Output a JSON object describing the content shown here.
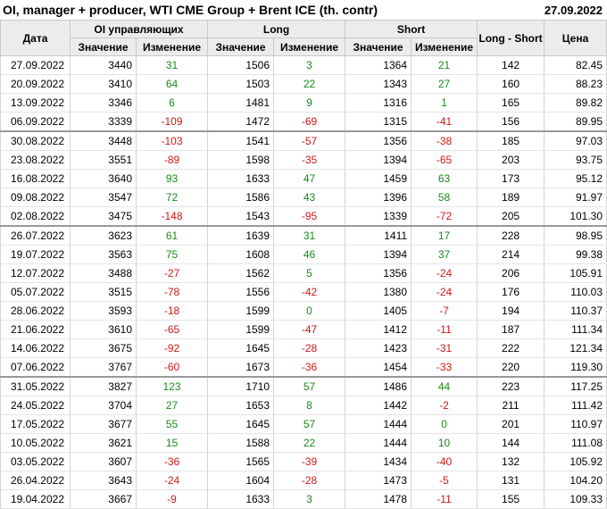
{
  "header": {
    "title": "OI, manager + producer, WTI CME Group + Brent ICE (th. contr)",
    "date": "27.09.2022"
  },
  "columns": {
    "date": "Дата",
    "oi_group": "OI управляющих",
    "long_group": "Long",
    "short_group": "Short",
    "long_short": "Long - Short",
    "price": "Цена",
    "value": "Значение",
    "change": "Изменение"
  },
  "rows": [
    {
      "date": "27.09.2022",
      "oi": "3440",
      "oi_chg": "31",
      "long": "1506",
      "long_chg": "3",
      "short": "1364",
      "short_chg": "21",
      "ls": "142",
      "price": "82.45"
    },
    {
      "date": "20.09.2022",
      "oi": "3410",
      "oi_chg": "64",
      "long": "1503",
      "long_chg": "22",
      "short": "1343",
      "short_chg": "27",
      "ls": "160",
      "price": "88.23"
    },
    {
      "date": "13.09.2022",
      "oi": "3346",
      "oi_chg": "6",
      "long": "1481",
      "long_chg": "9",
      "short": "1316",
      "short_chg": "1",
      "ls": "165",
      "price": "89.82"
    },
    {
      "date": "06.09.2022",
      "oi": "3339",
      "oi_chg": "-109",
      "long": "1472",
      "long_chg": "-69",
      "short": "1315",
      "short_chg": "-41",
      "ls": "156",
      "price": "89.95"
    },
    {
      "date": "30.08.2022",
      "oi": "3448",
      "oi_chg": "-103",
      "long": "1541",
      "long_chg": "-57",
      "short": "1356",
      "short_chg": "-38",
      "ls": "185",
      "price": "97.03",
      "sep": true
    },
    {
      "date": "23.08.2022",
      "oi": "3551",
      "oi_chg": "-89",
      "long": "1598",
      "long_chg": "-35",
      "short": "1394",
      "short_chg": "-65",
      "ls": "203",
      "price": "93.75"
    },
    {
      "date": "16.08.2022",
      "oi": "3640",
      "oi_chg": "93",
      "long": "1633",
      "long_chg": "47",
      "short": "1459",
      "short_chg": "63",
      "ls": "173",
      "price": "95.12"
    },
    {
      "date": "09.08.2022",
      "oi": "3547",
      "oi_chg": "72",
      "long": "1586",
      "long_chg": "43",
      "short": "1396",
      "short_chg": "58",
      "ls": "189",
      "price": "91.97"
    },
    {
      "date": "02.08.2022",
      "oi": "3475",
      "oi_chg": "-148",
      "long": "1543",
      "long_chg": "-95",
      "short": "1339",
      "short_chg": "-72",
      "ls": "205",
      "price": "101.30"
    },
    {
      "date": "26.07.2022",
      "oi": "3623",
      "oi_chg": "61",
      "long": "1639",
      "long_chg": "31",
      "short": "1411",
      "short_chg": "17",
      "ls": "228",
      "price": "98.95",
      "sep": true
    },
    {
      "date": "19.07.2022",
      "oi": "3563",
      "oi_chg": "75",
      "long": "1608",
      "long_chg": "46",
      "short": "1394",
      "short_chg": "37",
      "ls": "214",
      "price": "99.38"
    },
    {
      "date": "12.07.2022",
      "oi": "3488",
      "oi_chg": "-27",
      "long": "1562",
      "long_chg": "5",
      "short": "1356",
      "short_chg": "-24",
      "ls": "206",
      "price": "105.91"
    },
    {
      "date": "05.07.2022",
      "oi": "3515",
      "oi_chg": "-78",
      "long": "1556",
      "long_chg": "-42",
      "short": "1380",
      "short_chg": "-24",
      "ls": "176",
      "price": "110.03"
    },
    {
      "date": "28.06.2022",
      "oi": "3593",
      "oi_chg": "-18",
      "long": "1599",
      "long_chg": "0",
      "short": "1405",
      "short_chg": "-7",
      "ls": "194",
      "price": "110.37"
    },
    {
      "date": "21.06.2022",
      "oi": "3610",
      "oi_chg": "-65",
      "long": "1599",
      "long_chg": "-47",
      "short": "1412",
      "short_chg": "-11",
      "ls": "187",
      "price": "111.34"
    },
    {
      "date": "14.06.2022",
      "oi": "3675",
      "oi_chg": "-92",
      "long": "1645",
      "long_chg": "-28",
      "short": "1423",
      "short_chg": "-31",
      "ls": "222",
      "price": "121.34"
    },
    {
      "date": "07.06.2022",
      "oi": "3767",
      "oi_chg": "-60",
      "long": "1673",
      "long_chg": "-36",
      "short": "1454",
      "short_chg": "-33",
      "ls": "220",
      "price": "119.30"
    },
    {
      "date": "31.05.2022",
      "oi": "3827",
      "oi_chg": "123",
      "long": "1710",
      "long_chg": "57",
      "short": "1486",
      "short_chg": "44",
      "ls": "223",
      "price": "117.25",
      "sep": true
    },
    {
      "date": "24.05.2022",
      "oi": "3704",
      "oi_chg": "27",
      "long": "1653",
      "long_chg": "8",
      "short": "1442",
      "short_chg": "-2",
      "ls": "211",
      "price": "111.42"
    },
    {
      "date": "17.05.2022",
      "oi": "3677",
      "oi_chg": "55",
      "long": "1645",
      "long_chg": "57",
      "short": "1444",
      "short_chg": "0",
      "ls": "201",
      "price": "110.97"
    },
    {
      "date": "10.05.2022",
      "oi": "3621",
      "oi_chg": "15",
      "long": "1588",
      "long_chg": "22",
      "short": "1444",
      "short_chg": "10",
      "ls": "144",
      "price": "111.08"
    },
    {
      "date": "03.05.2022",
      "oi": "3607",
      "oi_chg": "-36",
      "long": "1565",
      "long_chg": "-39",
      "short": "1434",
      "short_chg": "-40",
      "ls": "132",
      "price": "105.92"
    },
    {
      "date": "26.04.2022",
      "oi": "3643",
      "oi_chg": "-24",
      "long": "1604",
      "long_chg": "-28",
      "short": "1473",
      "short_chg": "-5",
      "ls": "131",
      "price": "104.20"
    },
    {
      "date": "19.04.2022",
      "oi": "3667",
      "oi_chg": "-9",
      "long": "1633",
      "long_chg": "3",
      "short": "1478",
      "short_chg": "-11",
      "ls": "155",
      "price": "109.33"
    }
  ],
  "colors": {
    "positive": "#1a8a1a",
    "negative": "#d01818",
    "header_bg": "#ececec"
  }
}
